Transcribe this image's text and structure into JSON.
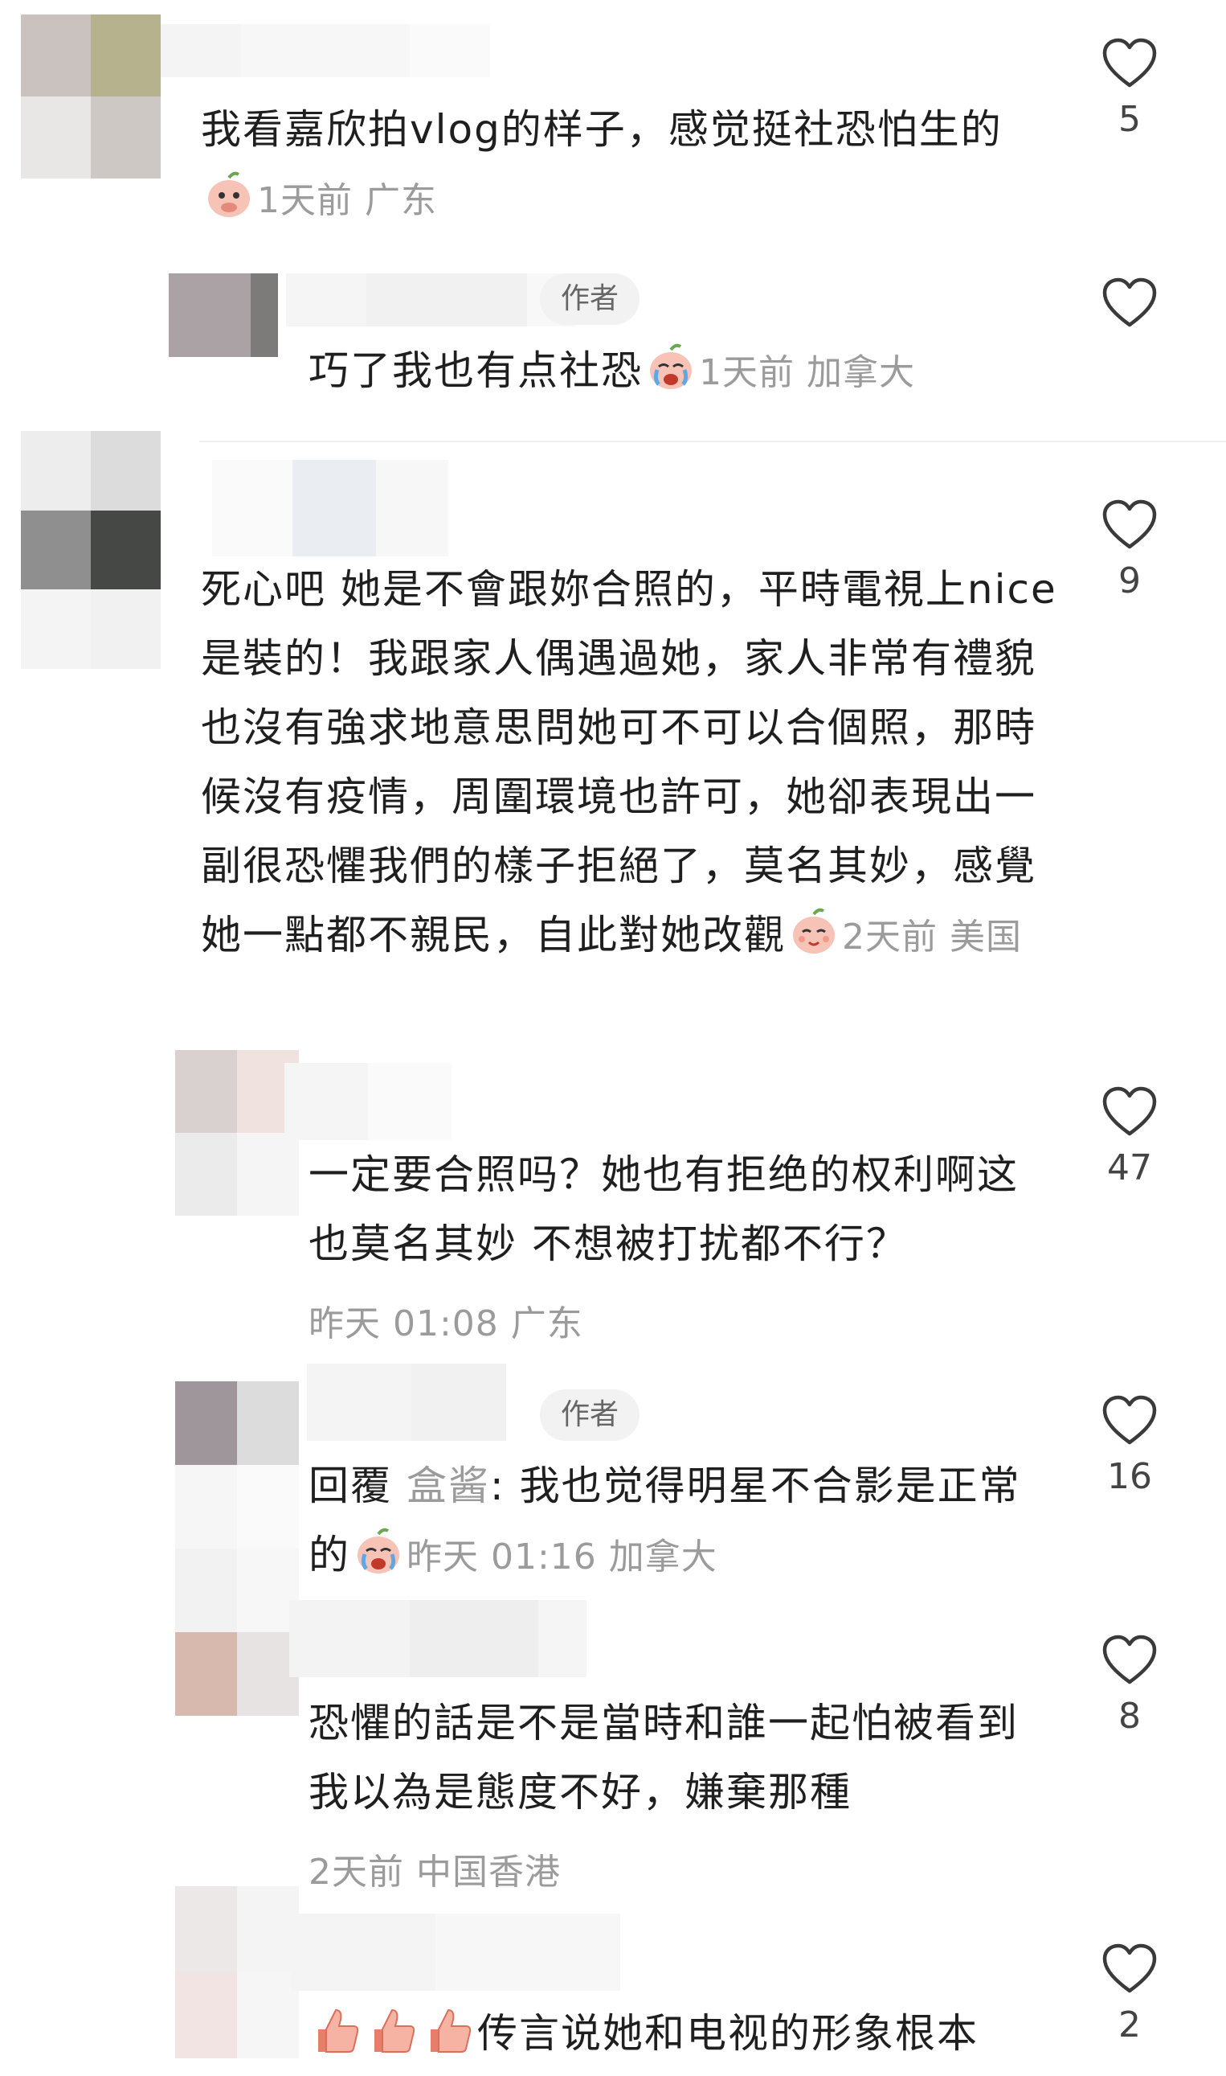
{
  "comments": [
    {
      "text": "我看嘉欣拍vlog的样子，感觉挺社恐怕生的",
      "meta": "1天前 广东",
      "likes": "5",
      "replies": [
        {
          "badge": "作者",
          "text": "巧了我也有点社恐",
          "meta": "1天前 加拿大",
          "likes": ""
        }
      ]
    },
    {
      "text": "死心吧 她是不會跟妳合照的，平時電視上nice是裝的！我跟家人偶遇過她，家人非常有禮貌也沒有強求地意思問她可不可以合個照，那時候沒有疫情，周圍環境也許可，她卻表現出一副很恐懼我們的樣子拒絕了，莫名其妙，感覺她一點都不親民，自此對她改觀",
      "meta": "2天前 美国",
      "likes": "9",
      "replies": [
        {
          "text": "一定要合照吗？她也有拒绝的权利啊这也莫名其妙 不想被打扰都不行？",
          "meta": "昨天 01:08 广东",
          "likes": "47"
        },
        {
          "badge": "作者",
          "prefix": "回覆 ",
          "reply_to": "盒酱",
          "text": ": 我也觉得明星不合影是正常的",
          "meta": "昨天 01:16 加拿大",
          "likes": "16"
        },
        {
          "text": "恐懼的話是不是當時和誰一起怕被看到我以為是態度不好，嫌棄那種",
          "meta": "2天前 中国香港",
          "likes": "8"
        },
        {
          "text": "传言说她和电视的形象根本",
          "meta": "",
          "likes": "2"
        }
      ]
    }
  ],
  "colors": {
    "meta": "#9b9b9b",
    "text": "#1f1f1f",
    "heart": "#3a3a3a"
  }
}
